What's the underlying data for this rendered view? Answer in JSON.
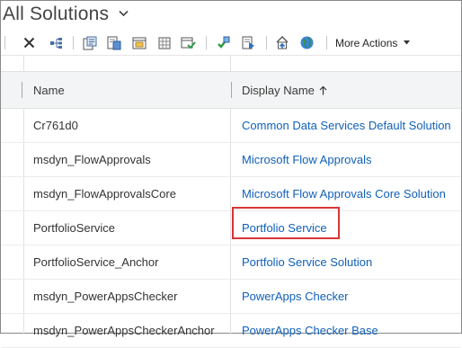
{
  "header": {
    "title": "All Solutions"
  },
  "toolbar": {
    "icons": [
      "delete-icon",
      "dependencies-icon",
      "publish-customizations-icon",
      "import-icon",
      "export-icon",
      "clone-icon",
      "apply-upgrade-icon",
      "refresh-icon",
      "clone-patch-icon",
      "solution-checker-icon",
      "web-resource-icon"
    ],
    "more_actions_label": "More Actions"
  },
  "grid": {
    "columns": {
      "name": "Name",
      "display_name": "Display Name"
    },
    "sort": {
      "column": "Display Name",
      "direction": "ascending"
    },
    "rows": [
      {
        "name": "Cr761d0",
        "display_name": "Common Data Services Default Solution"
      },
      {
        "name": "msdyn_FlowApprovals",
        "display_name": "Microsoft Flow Approvals"
      },
      {
        "name": "msdyn_FlowApprovalsCore",
        "display_name": "Microsoft Flow Approvals Core Solution"
      },
      {
        "name": "PortfolioService",
        "display_name": "Portfolio Service",
        "highlighted": true
      },
      {
        "name": "PortfolioService_Anchor",
        "display_name": "Portfolio Service Solution"
      },
      {
        "name": "msdyn_PowerAppsChecker",
        "display_name": "PowerApps Checker"
      },
      {
        "name": "msdyn_PowerAppsCheckerAnchor",
        "display_name": "PowerApps Checker Base"
      }
    ]
  },
  "colors": {
    "link": "#1160b7",
    "highlight_border": "#d83636",
    "header_bg": "#f3f4f5"
  }
}
